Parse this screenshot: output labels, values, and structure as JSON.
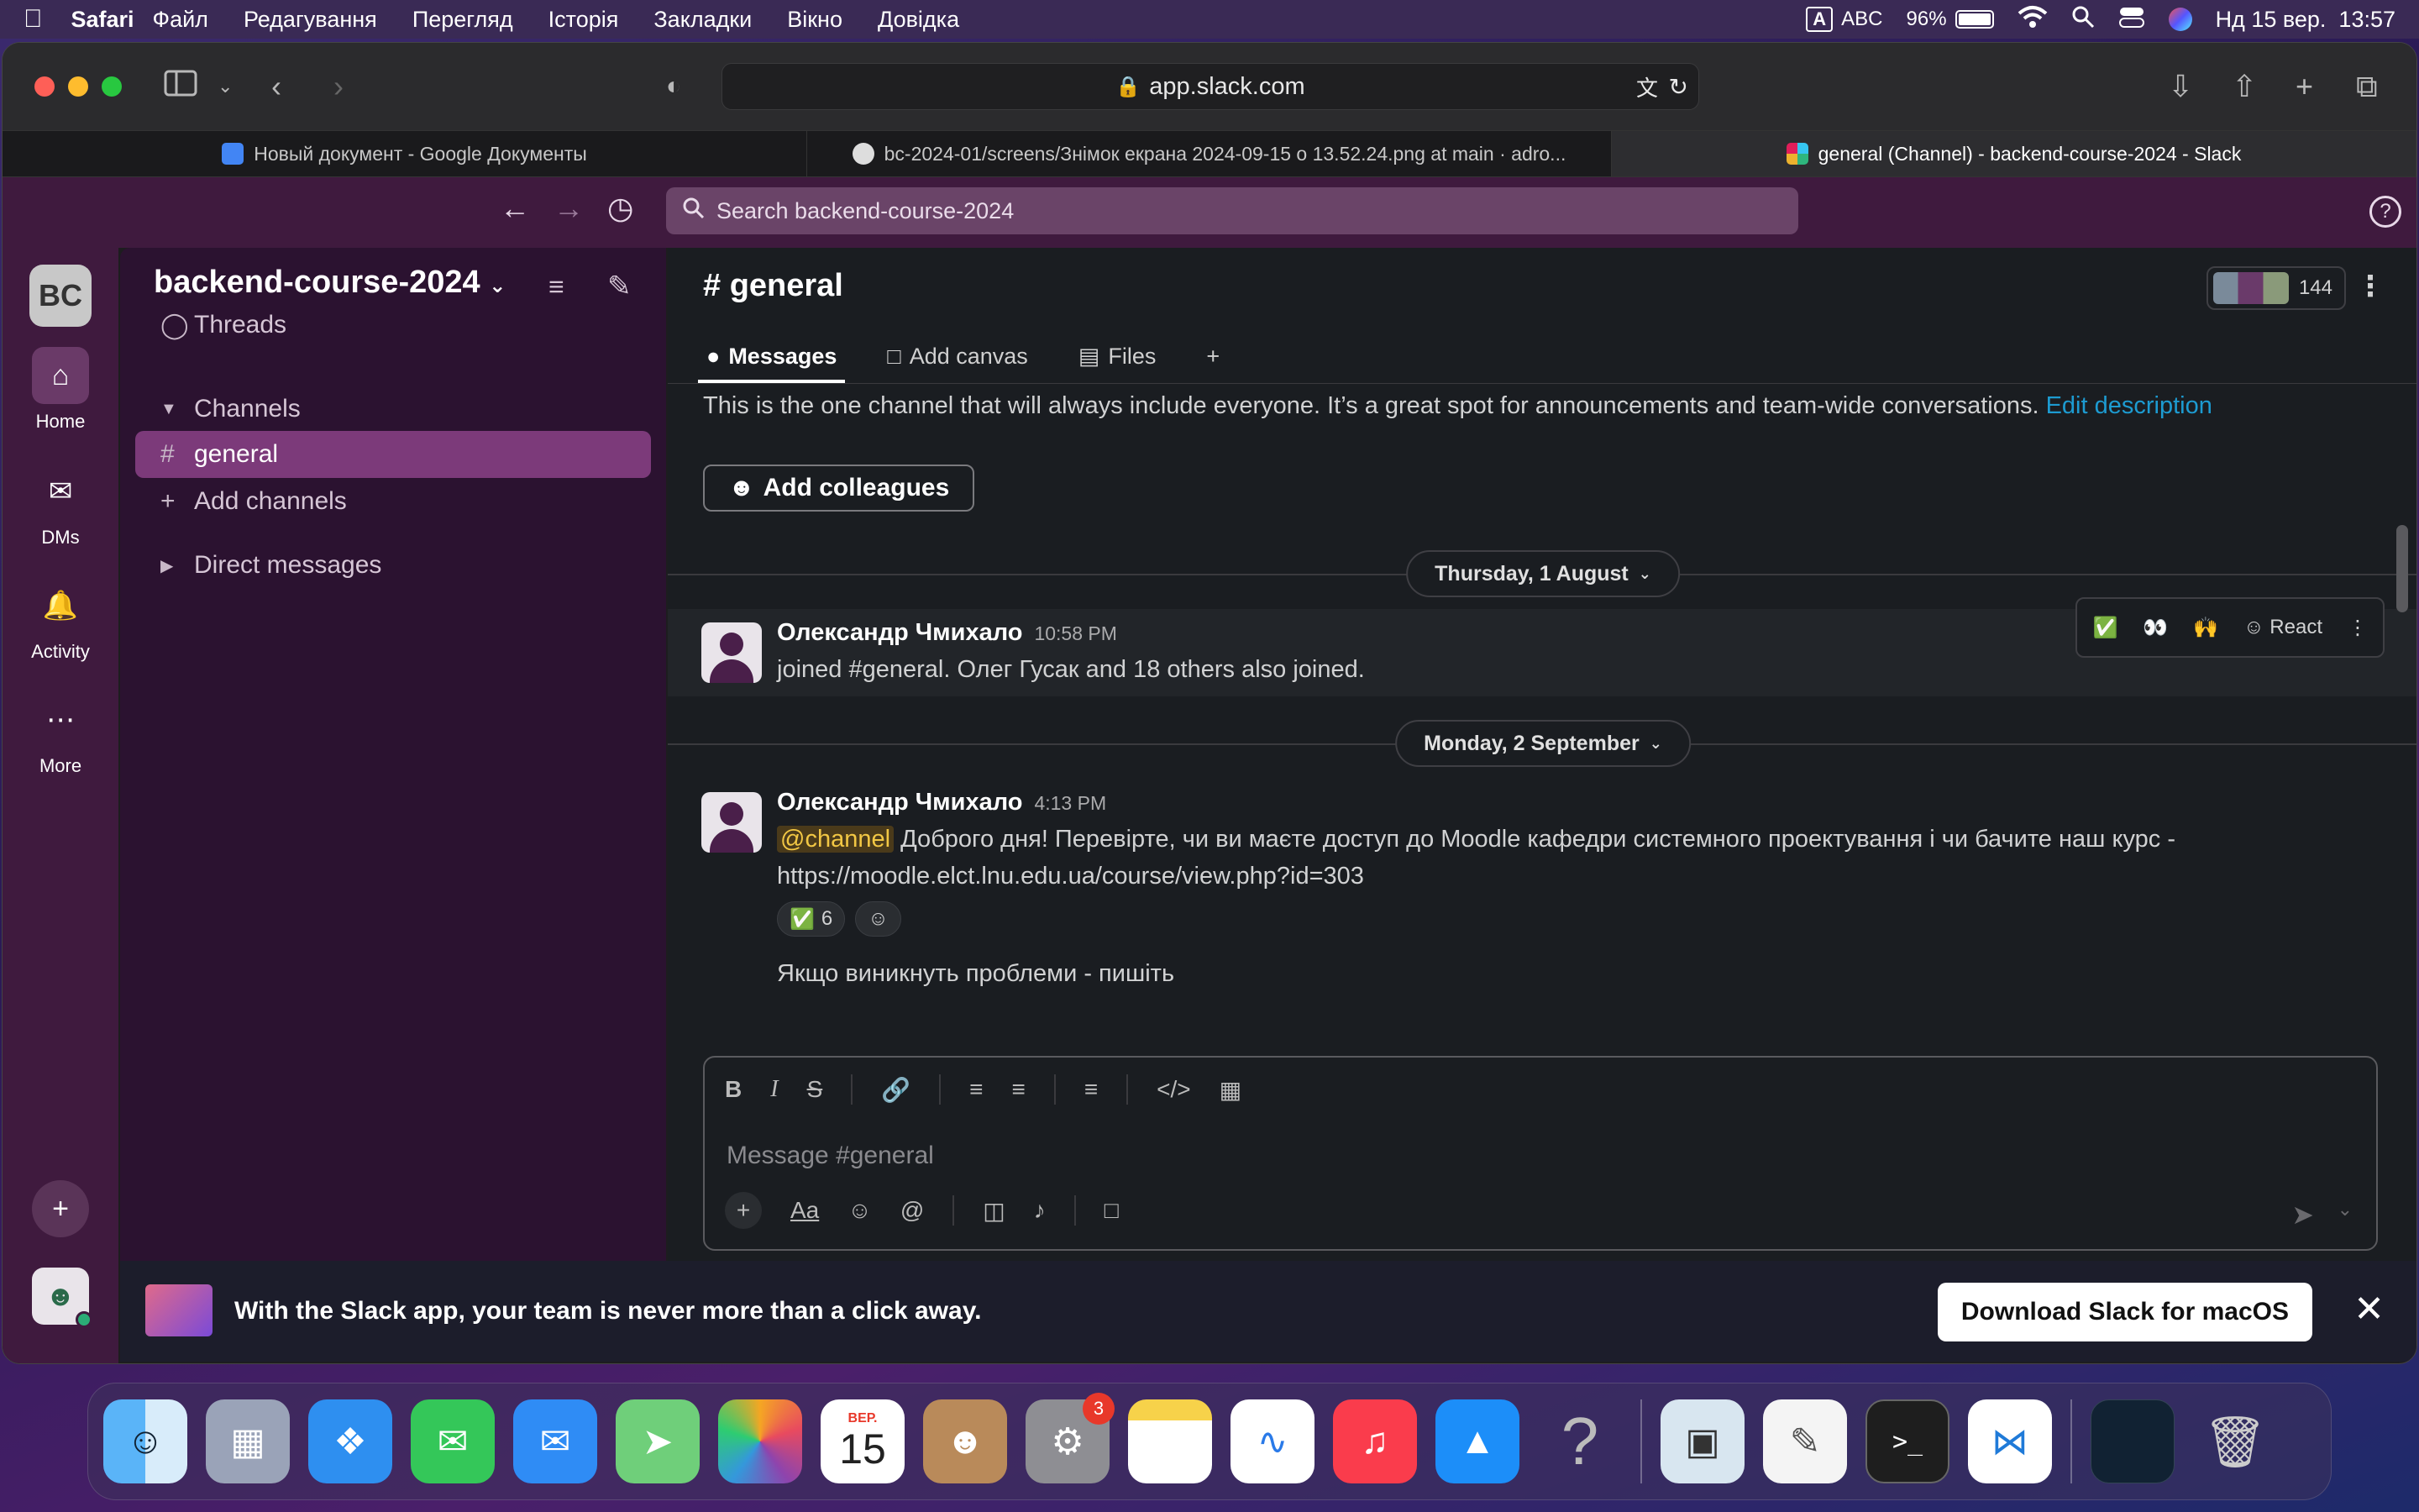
{
  "menubar": {
    "app": "Safari",
    "items": [
      "Файл",
      "Редагування",
      "Перегляд",
      "Історія",
      "Закладки",
      "Вікно",
      "Довідка"
    ],
    "input_indicator": "A",
    "input_name": "ABC",
    "battery": "96%",
    "datetime": "Нд 15 вер.  13:57"
  },
  "browser": {
    "url": "app.slack.com",
    "tabs": [
      {
        "title": "Новый документ - Google Документы"
      },
      {
        "title": "bc-2024-01/screens/Знімок екрана 2024-09-15 о 13.52.24.png at main · adro..."
      },
      {
        "title": "general (Channel) - backend-course-2024 - Slack"
      }
    ]
  },
  "slack": {
    "search_placeholder": "Search backend-course-2024",
    "workspace_initials": "BC",
    "rail": {
      "home": "Home",
      "dms": "DMs",
      "activity": "Activity",
      "more": "More"
    },
    "sidebar": {
      "workspace_name": "backend-course-2024",
      "threads": "Threads",
      "channels_header": "Channels",
      "channel_general": "general",
      "add_channels": "Add channels",
      "direct_messages": "Direct messages"
    },
    "channel": {
      "name": "# general",
      "member_count": "144",
      "tabs": {
        "messages": "Messages",
        "canvas": "Add canvas",
        "files": "Files"
      },
      "description": "This is the one channel that will always include everyone. It’s a great spot for announcements and team-wide conversations.",
      "edit_description": "Edit description",
      "add_colleagues": "Add colleagues",
      "date1": "Thursday, 1 August",
      "date2": "Monday, 2 September",
      "msg1": {
        "author": "Олександр Чмихало",
        "time": "10:58 PM",
        "text": "joined #general. Олег Гусак and 18 others also joined."
      },
      "hover_react": "React",
      "msg2": {
        "author": "Олександр Чмихало",
        "time": "4:13 PM",
        "mention": "@channel",
        "text": "Доброго дня! Перевірте, чи ви маєте доступ до Moodle кафедри системного проектування  і чи бачите наш курс -",
        "link": "https://moodle.elct.lnu.edu.ua/course/view.php?id=303",
        "reaction_count": "6",
        "cut_text": "Якщо виникнуть проблеми - пишіть"
      },
      "composer_placeholder": "Message #general"
    },
    "banner": {
      "text": "With the Slack app, your team is never more than a click away.",
      "button": "Download Slack for macOS"
    }
  },
  "dock": {
    "calendar_month": "ВЕР.",
    "calendar_day": "15",
    "settings_badge": "3"
  }
}
